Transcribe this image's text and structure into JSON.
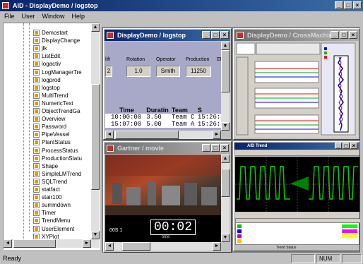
{
  "app": {
    "title": "AID - DisplayDemo / logstop",
    "menu": [
      "File",
      "User",
      "Window",
      "Help"
    ]
  },
  "tree": {
    "items": [
      "Demostart",
      "DisplayChange",
      "jlk",
      "ListEdit",
      "logactiv",
      "LogManagerTre",
      "logprod",
      "logstop",
      "MultiTrend",
      "NumericText",
      "ObjectTrendGa",
      "Overview",
      "Password",
      "PipeVessel",
      "PlantStatus",
      "ProcessStatus",
      "ProductionStatu",
      "Shape",
      "SimpleLMTrend",
      "SQLTrend",
      "statfact",
      "stair100",
      "summdown",
      "Timer",
      "TrendMenu",
      "UserElement",
      "XYPlot"
    ]
  },
  "logstop": {
    "title": "DisplayDemo / logstop",
    "field_labels": [
      "Rotation",
      "Operator",
      "Production"
    ],
    "field_values": [
      "1.0",
      "Smith",
      "11250",
      "2"
    ],
    "partial_label_left": "lift",
    "partial_label_right": "EF",
    "columns": [
      "Time",
      "Duratin",
      "Team",
      "S"
    ],
    "rows": [
      [
        "10:00:00",
        "3.50",
        "Team C",
        "15:26:42"
      ],
      [
        "15:07:00",
        "5.00",
        "Team A",
        "15:26:42"
      ]
    ]
  },
  "crossmachine": {
    "title": "DisplayDemo / CrossMachine"
  },
  "movie": {
    "title": "Gartner / movie",
    "counter_label": "00S 1",
    "time": "00:02",
    "time_caption": "time"
  },
  "trend": {
    "title": "AID Trend"
  },
  "status": {
    "ready": "Ready",
    "num": "NUM",
    "footer_label": "Trend Status"
  },
  "colors": {
    "active_title": "#0a246a",
    "trend_bg": "#000000",
    "trend_line": "#00d000"
  }
}
